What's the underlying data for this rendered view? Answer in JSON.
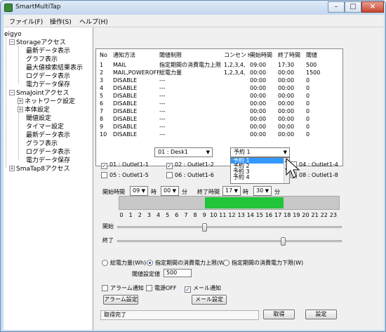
{
  "window": {
    "title": "SmartMultiTap"
  },
  "menu": {
    "file": "ファイル(F)",
    "operation": "操作(S)",
    "help": "ヘルプ(H)"
  },
  "tree": {
    "root": "eigyo",
    "storage": "Storageアクセス",
    "storage_children": [
      "最新データ表示",
      "グラフ表示",
      "最大値検索結果表示",
      "ログデータ表示",
      "電力データ保存"
    ],
    "smajoint": "SmaJointアクセス",
    "smajoint_children": [
      "ネットワーク設定",
      "本体設定",
      "閾値設定",
      "タイマー設定",
      "最新データ表示",
      "グラフ表示",
      "ログデータ表示",
      "電力データ保存"
    ],
    "smatap": "SmaTap8アクセス"
  },
  "table": {
    "headers": [
      "No",
      "通知方法",
      "閾値制限",
      "コンセント",
      "開始時間",
      "終了時間",
      "閾値"
    ],
    "rows": [
      [
        "1",
        "MAIL",
        "指定期間の消費電力上限",
        "1,2,3,4,",
        "09:00",
        "17:30",
        "500"
      ],
      [
        "2",
        "MAIL,POWEROFF",
        "総電力量",
        "1,2,3,4,",
        "00:00",
        "00:00",
        "1500"
      ],
      [
        "3",
        "DISABLE",
        "---",
        "",
        "00:00",
        "00:00",
        "0"
      ],
      [
        "4",
        "DISABLE",
        "---",
        "",
        "00:00",
        "00:00",
        "0"
      ],
      [
        "5",
        "DISABLE",
        "---",
        "",
        "00:00",
        "00:00",
        "0"
      ],
      [
        "6",
        "DISABLE",
        "---",
        "",
        "00:00",
        "00:00",
        "0"
      ],
      [
        "7",
        "DISABLE",
        "---",
        "",
        "00:00",
        "00:00",
        "0"
      ],
      [
        "8",
        "DISABLE",
        "---",
        "",
        "00:00",
        "00:00",
        "0"
      ],
      [
        "9",
        "DISABLE",
        "---",
        "",
        "00:00",
        "00:00",
        "0"
      ],
      [
        "10",
        "DISABLE",
        "---",
        "",
        "00:00",
        "00:00",
        "0"
      ]
    ]
  },
  "desk_select": {
    "value": "01 : Desk1"
  },
  "schedule_select": {
    "value": "予約 1",
    "options": [
      "予約 1",
      "予約 2",
      "予約 3",
      "予約 4"
    ]
  },
  "outlets": [
    {
      "label": "01 : Outlet1-1",
      "checked": true
    },
    {
      "label": "02 : Outlet1-2",
      "checked": true
    },
    {
      "label": "04 : Outlet1-4",
      "checked": false
    },
    {
      "label": "05 : Outlet1-5",
      "checked": false
    },
    {
      "label": "06 : Outlet1-6",
      "checked": false
    },
    {
      "label": "08 : Outlet1-8",
      "checked": false
    }
  ],
  "time": {
    "start_label": "開始時間",
    "start_hour": "09",
    "start_min": "00",
    "end_label": "終了時間",
    "end_hour": "17",
    "end_min": "30",
    "hour_unit": "時",
    "min_unit": "分"
  },
  "timeline": {
    "hours": [
      "0",
      "1",
      "2",
      "3",
      "4",
      "5",
      "6",
      "7",
      "8",
      "9",
      "10",
      "11",
      "12",
      "13",
      "14",
      "15",
      "16",
      "17",
      "18",
      "19",
      "20",
      "21",
      "22",
      "23"
    ],
    "active_start": 9,
    "active_end": 17.5,
    "active_color": "#22c43a"
  },
  "sliders": {
    "start_label": "開始",
    "end_label": "終了",
    "start_value": 9,
    "end_value": 17.5
  },
  "radios": {
    "total": "総電力量(Wh)",
    "upper": "指定期間の消費電力上限(W)",
    "lower": "指定期間の消費電力下限(W)",
    "selected": "upper"
  },
  "threshold": {
    "label": "閾値設定値",
    "value": "500"
  },
  "notify": {
    "alarm": "アラーム通知",
    "power_off": "電源OFF",
    "mail": "メール通知",
    "mail_checked": true,
    "check_mark": "✓"
  },
  "buttons": {
    "alarm_settings": "アラーム設定",
    "mail_settings": "メール設定",
    "get": "取得",
    "set": "設定"
  },
  "status": {
    "text": "取得完了"
  },
  "colors": {
    "accent": "#3399ff"
  }
}
